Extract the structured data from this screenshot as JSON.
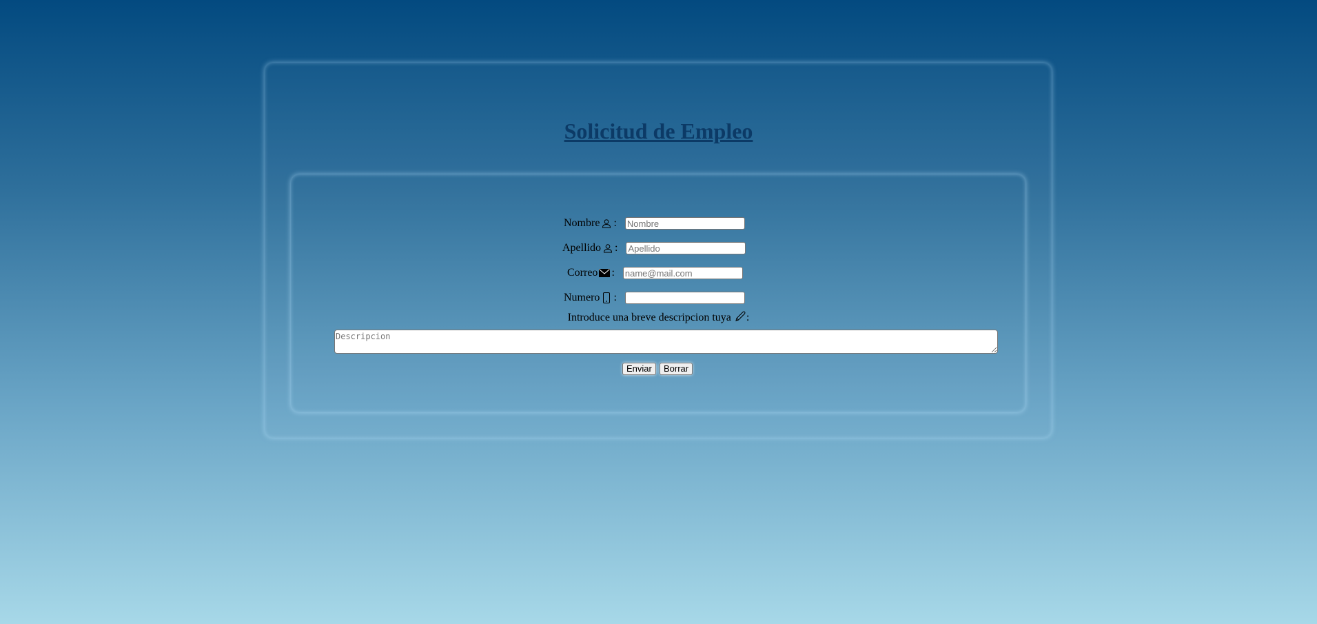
{
  "page": {
    "title": "Solicitud de Empleo"
  },
  "form": {
    "fields": [
      {
        "label": "Nombre",
        "icon": "person-icon",
        "placeholder": "Nombre",
        "value": ""
      },
      {
        "label": "Apellido",
        "icon": "person-icon",
        "placeholder": "Apellido",
        "value": ""
      },
      {
        "label": "Correo",
        "icon": "envelope-icon",
        "placeholder": "name@mail.com",
        "value": ""
      },
      {
        "label": "Numero",
        "icon": "phone-icon",
        "placeholder": "",
        "value": ""
      }
    ],
    "colon": ":",
    "description": {
      "label": "Introduce una breve descripcion tuya",
      "icon": "pencil-icon",
      "placeholder": "Descripcion"
    },
    "submit_label": "Enviar",
    "reset_label": "Borrar"
  },
  "colors": {
    "background_top": "#034a80",
    "background_bottom": "#a7d8e8",
    "title": "#0c3a66"
  }
}
